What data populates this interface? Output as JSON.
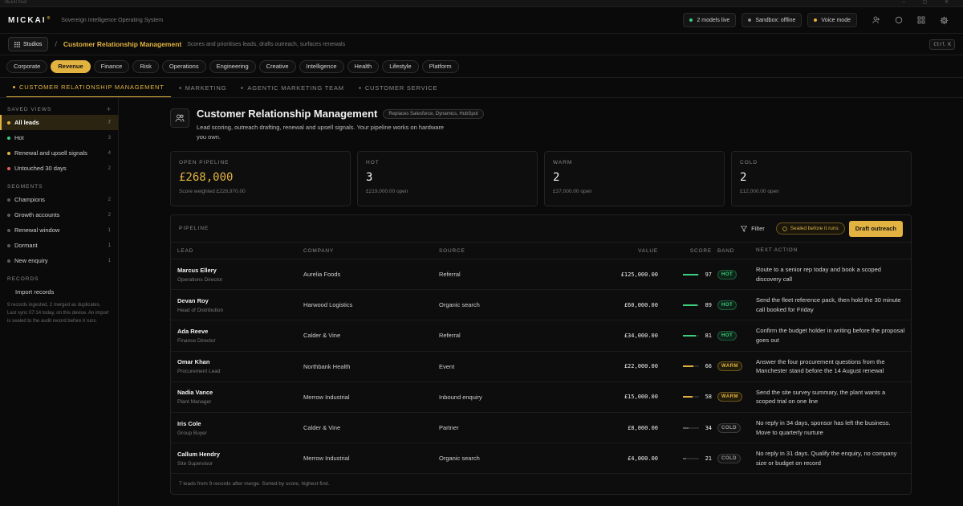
{
  "window": {
    "title": "MickAI Shell"
  },
  "topbar": {
    "logo": "MICKAI",
    "logo_mark": "®",
    "tagline": "Sovereign Intelligence Operating System",
    "status_pills": [
      {
        "label": "2 models live",
        "color": "#3ccf7e"
      },
      {
        "label": "Sandbox: offline",
        "color": "#8a8a8a"
      },
      {
        "label": "Voice mode",
        "color": "#e3b341"
      }
    ],
    "icons": [
      "user-icon",
      "circle-icon",
      "grid-icon",
      "gear-icon"
    ]
  },
  "breadcrumb": {
    "studios_label": "Studios",
    "separator": "/",
    "title": "Customer Relationship Management",
    "description": "Scores and prioritises leads, drafts outreach, surfaces renewals",
    "shortcut": "Ctrl K"
  },
  "categories": [
    "Corporate",
    "Revenue",
    "Finance",
    "Risk",
    "Operations",
    "Engineering",
    "Creative",
    "Intelligence",
    "Health",
    "Lifestyle",
    "Platform"
  ],
  "active_category": "Revenue",
  "subtabs": [
    {
      "label": "CUSTOMER RELATIONSHIP MANAGEMENT",
      "active": true
    },
    {
      "label": "MARKETING",
      "active": false
    },
    {
      "label": "AGENTIC MARKETING TEAM",
      "active": false
    },
    {
      "label": "CUSTOMER SERVICE",
      "active": false
    }
  ],
  "sidebar": {
    "saved_views_title": "SAVED VIEWS",
    "saved_views": [
      {
        "label": "All leads",
        "count": "7",
        "color": "#e3b341",
        "active": true
      },
      {
        "label": "Hot",
        "count": "3",
        "color": "#3ccf7e"
      },
      {
        "label": "Renewal and upsell signals",
        "count": "4",
        "color": "#e3b341"
      },
      {
        "label": "Untouched 30 days",
        "count": "2",
        "color": "#e5625a"
      }
    ],
    "segments_title": "SEGMENTS",
    "segments": [
      {
        "label": "Champions",
        "count": "2"
      },
      {
        "label": "Growth accounts",
        "count": "2"
      },
      {
        "label": "Renewal window",
        "count": "1"
      },
      {
        "label": "Dormant",
        "count": "1"
      },
      {
        "label": "New enquiry",
        "count": "1"
      }
    ],
    "records_title": "RECORDS",
    "import_label": "Import records",
    "records_note": "9 records ingested, 2 merged as duplicates. Last sync 07:14 today, on this device. An import is sealed to the audit record before it runs."
  },
  "hero": {
    "title": "Customer Relationship Management",
    "badge": "Replaces Salesforce, Dynamics, HubSpot",
    "description": "Lead scoring, outreach drafting, renewal and upsell signals. Your pipeline works on hardware you own."
  },
  "stats": [
    {
      "label": "OPEN PIPELINE",
      "value": "£268,000",
      "sub": "Score weighted £228,970.00",
      "gold": true
    },
    {
      "label": "HOT",
      "value": "3",
      "sub": "£219,000.00 open"
    },
    {
      "label": "WARM",
      "value": "2",
      "sub": "£37,000.00 open"
    },
    {
      "label": "COLD",
      "value": "2",
      "sub": "£12,000.00 open"
    }
  ],
  "pipeline": {
    "title": "PIPELINE",
    "filter_label": "Filter",
    "sealed_label": "Sealed before it runs",
    "draft_label": "Draft outreach",
    "columns": [
      "LEAD",
      "COMPANY",
      "SOURCE",
      "VALUE",
      "SCORE",
      "BAND",
      "NEXT ACTION"
    ],
    "rows": [
      {
        "name": "Marcus Ellery",
        "role": "Operations Director",
        "company": "Aurelia Foods",
        "source": "Referral",
        "value": "£125,000.00",
        "score": 97,
        "band": "HOT",
        "next": "Route to a senior rep today and book a scoped discovery call"
      },
      {
        "name": "Devan Roy",
        "role": "Head of Distribution",
        "company": "Harwood Logistics",
        "source": "Organic search",
        "value": "£60,000.00",
        "score": 89,
        "band": "HOT",
        "next": "Send the fleet reference pack, then hold the 30 minute call booked for Friday"
      },
      {
        "name": "Ada Reeve",
        "role": "Finance Director",
        "company": "Calder & Vine",
        "source": "Referral",
        "value": "£34,000.00",
        "score": 81,
        "band": "HOT",
        "next": "Confirm the budget holder in writing before the proposal goes out"
      },
      {
        "name": "Omar Khan",
        "role": "Procurement Lead",
        "company": "Northbank Health",
        "source": "Event",
        "value": "£22,000.00",
        "score": 66,
        "band": "WARM",
        "next": "Answer the four procurement questions from the Manchester stand before the 14 August renewal"
      },
      {
        "name": "Nadia Vance",
        "role": "Plant Manager",
        "company": "Merrow Industrial",
        "source": "Inbound enquiry",
        "value": "£15,000.00",
        "score": 58,
        "band": "WARM",
        "next": "Send the site survey summary, the plant wants a scoped trial on one line"
      },
      {
        "name": "Iris Cole",
        "role": "Group Buyer",
        "company": "Calder & Vine",
        "source": "Partner",
        "value": "£8,000.00",
        "score": 34,
        "band": "COLD",
        "next": "No reply in 34 days, sponsor has left the business. Move to quarterly nurture"
      },
      {
        "name": "Callum Hendry",
        "role": "Site Supervisor",
        "company": "Merrow Industrial",
        "source": "Organic search",
        "value": "£4,000.00",
        "score": 21,
        "band": "COLD",
        "next": "No reply in 31 days. Qualify the enquiry, no company size or budget on record"
      }
    ],
    "footer": "7 leads from 9 records after merge. Sorted by score, highest first."
  },
  "colors": {
    "accent": "#e3b341",
    "hot": "#3ccf7e",
    "warm": "#e3b341",
    "cold": "#5a5a5a",
    "alert": "#e5625a"
  }
}
